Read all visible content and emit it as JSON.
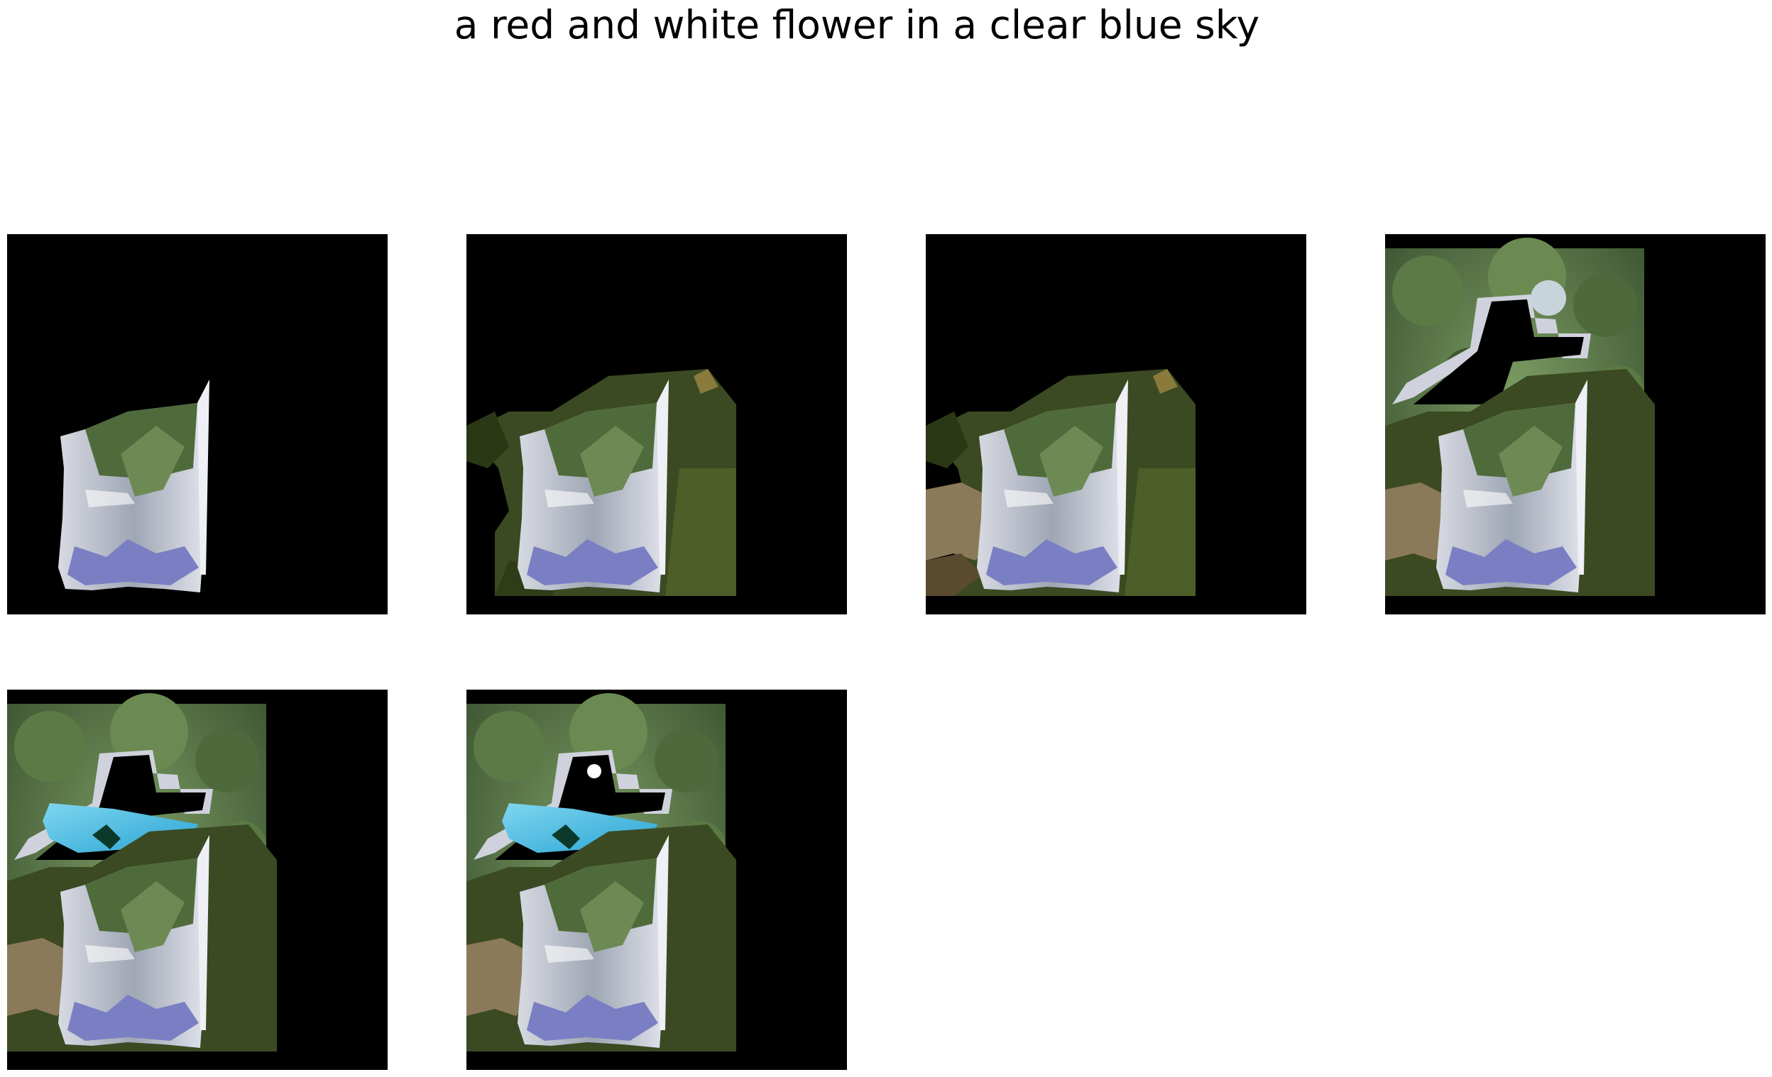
{
  "title": "a red and white flower in a clear blue sky",
  "panels": [
    {
      "index": 1,
      "stage": "object-only"
    },
    {
      "index": 2,
      "stage": "object-with-foliage"
    },
    {
      "index": 3,
      "stage": "object-with-foliage-and-ground"
    },
    {
      "index": 4,
      "stage": "object-with-canopy-frame"
    },
    {
      "index": 5,
      "stage": "object-with-blue-sky"
    },
    {
      "index": 6,
      "stage": "object-with-blue-sky-filled"
    }
  ],
  "colors": {
    "background": "#000000",
    "page": "#ffffff",
    "sky": "#3fb4dc",
    "foliage": "#3b4a22",
    "bag": "#c9ccd6",
    "bag_accent": "#7a7fc4",
    "leaf": "#4f6b3c",
    "ground": "#8b7a5a"
  }
}
